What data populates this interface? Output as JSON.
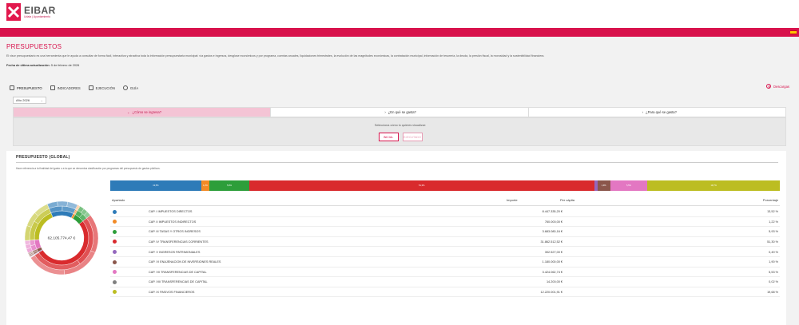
{
  "header": {
    "logo_name": "EIBAR",
    "logo_sub": "Udala | Ayuntamiento",
    "brand_color": "#d8124c"
  },
  "page": {
    "title": "PRESUPUESTOS",
    "description": "El visor presupuestario es una herramienta que le ayuda a consultar de forma fácil, interactiva y atractiva toda la información presupuestaria municipal: vía gastos e ingresos, desglose económicos y por programa, cuentas anuales, liquidaciones trimestrales, la evolución de las magnitudes económicas, la contratación municipal, información de tesorería, la deuda, la presión fiscal, la morosidad y la sostenibilidad financiera.",
    "update_label": "Fecha de última actualización:",
    "update_value": "5 de febrero de 2026"
  },
  "nav": {
    "tabs": [
      {
        "label": "PRESUPUESTO",
        "icon": "budget-icon"
      },
      {
        "label": "INDICADORES",
        "icon": "indicators-icon"
      },
      {
        "label": "EJECUCIÓN",
        "icon": "execution-icon"
      },
      {
        "label": "GUÍA",
        "icon": "guide-icon"
      }
    ],
    "download_label": "Descargas"
  },
  "year_select": {
    "value": "Año 2026"
  },
  "question_tabs": [
    {
      "label": "¿Cómo se ingresa?",
      "active": true
    },
    {
      "label": "¿En qué se gasta?",
      "active": false
    },
    {
      "label": "¿Para qué se gasta?",
      "active": false
    }
  ],
  "visualize": {
    "prompt": "Selecciona cómo lo quieres visualizar:",
    "buttons": [
      "INICIAL",
      "EJECUTADO"
    ]
  },
  "section": {
    "title": "PRESUPUESTO (GLOBAL)",
    "note": "Hace referencia a la finalidad del gasto o a la que se denomina clasificación por programas del presupuesto de gastos públicos.",
    "total": "62.105.774,47 €",
    "columns": {
      "apartado": "Apartado",
      "importe": "Importe",
      "per_capita": "Per cápita",
      "porcentaje": "Porcentaje"
    }
  },
  "chart_data": {
    "type": "bar",
    "categories": [
      "CAP. I IMPUESTOS DIRECTOS",
      "CAP. II IMPUESTOS INDIRECTOS",
      "CAP. III TASAS Y OTROS INGRESOS",
      "CAP. IV TRANSFERENCIAS CORRIENTES",
      "CAP. V INGRESOS PATRIMONIALES",
      "CAP. VI ENAJENACION DE INVERSIONES REALES",
      "CAP. VII TRANSFERENCIAS DE CAPITAL",
      "CAP. VIII TRANSFERENCIAS DE CAPITAL",
      "CAP. IX PASIVOS FINANCIEROS"
    ],
    "importe": [
      "8.447.335,20 €",
      "760.000,00 €",
      "3.683.080,16 €",
      "31.862.512,52 €",
      "302.527,00 €",
      "1.180.000,00 €",
      "3.424.062,74 €",
      "14.200,00 €",
      "12.220.001,91 €"
    ],
    "values": [
      13.52,
      1.22,
      5.93,
      51.3,
      0.49,
      1.9,
      5.53,
      0.02,
      19.68
    ],
    "percent_labels": [
      "13,52 %",
      "1,22 %",
      "5,93 %",
      "51,30 %",
      "0,49 %",
      "1,90 %",
      "5,53 %",
      "0,02 %",
      "19,68 %"
    ],
    "bar_labels": [
      "13,5%",
      "1,2%",
      "5,9%",
      "51,3%",
      "",
      "1,9%",
      "5,5%",
      "",
      "19,7%"
    ],
    "colors": [
      "#2e7bb8",
      "#f28a26",
      "#2d9e3a",
      "#d92a2d",
      "#9467bd",
      "#8b564b",
      "#e377c2",
      "#7f7f7f",
      "#bcbd22"
    ]
  }
}
